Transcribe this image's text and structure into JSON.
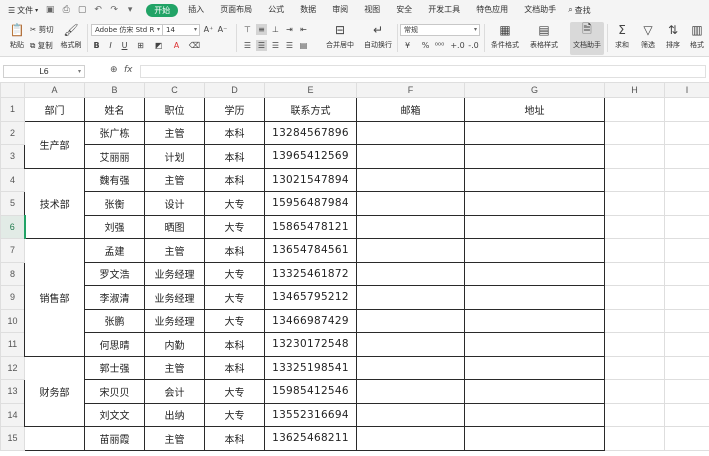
{
  "menu": {
    "file": "文件",
    "tabs": [
      "开始",
      "插入",
      "页面布局",
      "公式",
      "数据",
      "审阅",
      "视图",
      "安全",
      "开发工具",
      "特色应用",
      "文档助手"
    ],
    "active_tab": "开始",
    "search": "查找"
  },
  "ribbon": {
    "paste": "粘贴",
    "cut": "剪切",
    "copy": "复制",
    "format_painter": "格式刷",
    "font_name": "Adobe 仿宋 Std R",
    "font_size": "14",
    "merge": "合并居中",
    "wrap": "自动换行",
    "number_format": "常规",
    "cond_format": "条件格式",
    "table_style": "表格样式",
    "doc_helper": "文档助手",
    "sum": "求和",
    "filter": "筛选",
    "sort": "排序",
    "format": "格式"
  },
  "formula_bar": {
    "cell_ref": "L6",
    "fx": "fx",
    "value": ""
  },
  "columns": [
    "A",
    "B",
    "C",
    "D",
    "E",
    "F",
    "G",
    "H",
    "I"
  ],
  "rows": [
    "1",
    "2",
    "3",
    "4",
    "5",
    "6",
    "7",
    "8",
    "9",
    "10",
    "11",
    "12",
    "13",
    "14",
    "15"
  ],
  "active_row": "6",
  "headers": [
    "部门",
    "姓名",
    "职位",
    "学历",
    "联系方式",
    "邮箱",
    "地址"
  ],
  "departments": [
    "生产部",
    "技术部",
    "销售部",
    "财务部"
  ],
  "records": [
    [
      "张广栋",
      "主管",
      "本科",
      "13284567896"
    ],
    [
      "艾丽丽",
      "计划",
      "本科",
      "13965412569"
    ],
    [
      "魏有强",
      "主管",
      "本科",
      "13021547894"
    ],
    [
      "张衡",
      "设计",
      "大专",
      "15956487984"
    ],
    [
      "刘强",
      "晒图",
      "大专",
      "15865478121"
    ],
    [
      "孟建",
      "主管",
      "本科",
      "13654784561"
    ],
    [
      "罗文浩",
      "业务经理",
      "大专",
      "13325461872"
    ],
    [
      "李淑清",
      "业务经理",
      "大专",
      "13465795212"
    ],
    [
      "张鹏",
      "业务经理",
      "大专",
      "13466987429"
    ],
    [
      "何思晴",
      "内勤",
      "本科",
      "13230172548"
    ],
    [
      "郭士强",
      "主管",
      "本科",
      "13325198541"
    ],
    [
      "宋贝贝",
      "会计",
      "大专",
      "15985412546"
    ],
    [
      "刘文文",
      "出纳",
      "大专",
      "13552316694"
    ],
    [
      "苗丽霞",
      "主管",
      "本科",
      "13625468211"
    ]
  ],
  "colors": {
    "accent": "#21a366",
    "grid_line": "#dedede",
    "cell_border": "#2a2a2a"
  }
}
